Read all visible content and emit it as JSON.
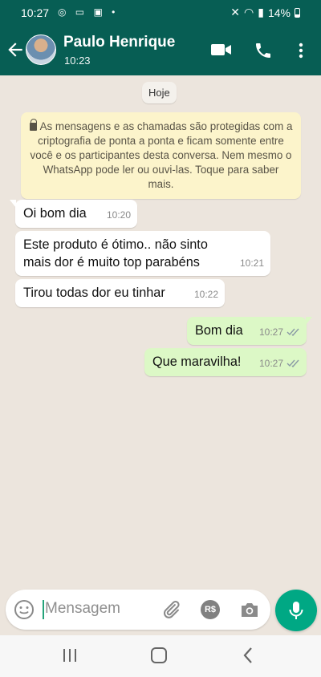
{
  "status": {
    "time": "10:27",
    "battery": "14%"
  },
  "header": {
    "contact_name": "Paulo Henrique",
    "last_seen": "10:23"
  },
  "chat": {
    "date_chip": "Hoje",
    "encryption_notice": "As mensagens e as chamadas são protegidas com a criptografia de ponta a ponta e ficam somente entre você e os participantes desta conversa. Nem mesmo o WhatsApp pode ler ou ouvi-las. Toque para saber mais.",
    "messages": [
      {
        "direction": "incoming",
        "text": "Oi bom dia",
        "time": "10:20"
      },
      {
        "direction": "incoming",
        "text": "Este produto é ótimo.. não sinto mais dor é muito top parabéns",
        "time": "10:21"
      },
      {
        "direction": "incoming",
        "text": "Tirou todas dor eu tinhar",
        "time": "10:22"
      },
      {
        "direction": "outgoing",
        "text": "Bom dia",
        "time": "10:27",
        "status": "read"
      },
      {
        "direction": "outgoing",
        "text": "Que maravilha!",
        "time": "10:27",
        "status": "read"
      }
    ]
  },
  "composer": {
    "placeholder": "Mensagem",
    "payment_label": "R$"
  },
  "colors": {
    "header": "#075E54",
    "outgoing_bubble": "#DCF8C6",
    "incoming_bubble": "#FFFFFF",
    "accent": "#00A884",
    "wallpaper": "#ECE5DD"
  },
  "icons": [
    "back-arrow-icon",
    "video-call-icon",
    "phone-icon",
    "more-options-icon",
    "lock-icon",
    "double-check-icon",
    "emoji-icon",
    "paperclip-icon",
    "payment-icon",
    "camera-icon",
    "microphone-icon"
  ]
}
